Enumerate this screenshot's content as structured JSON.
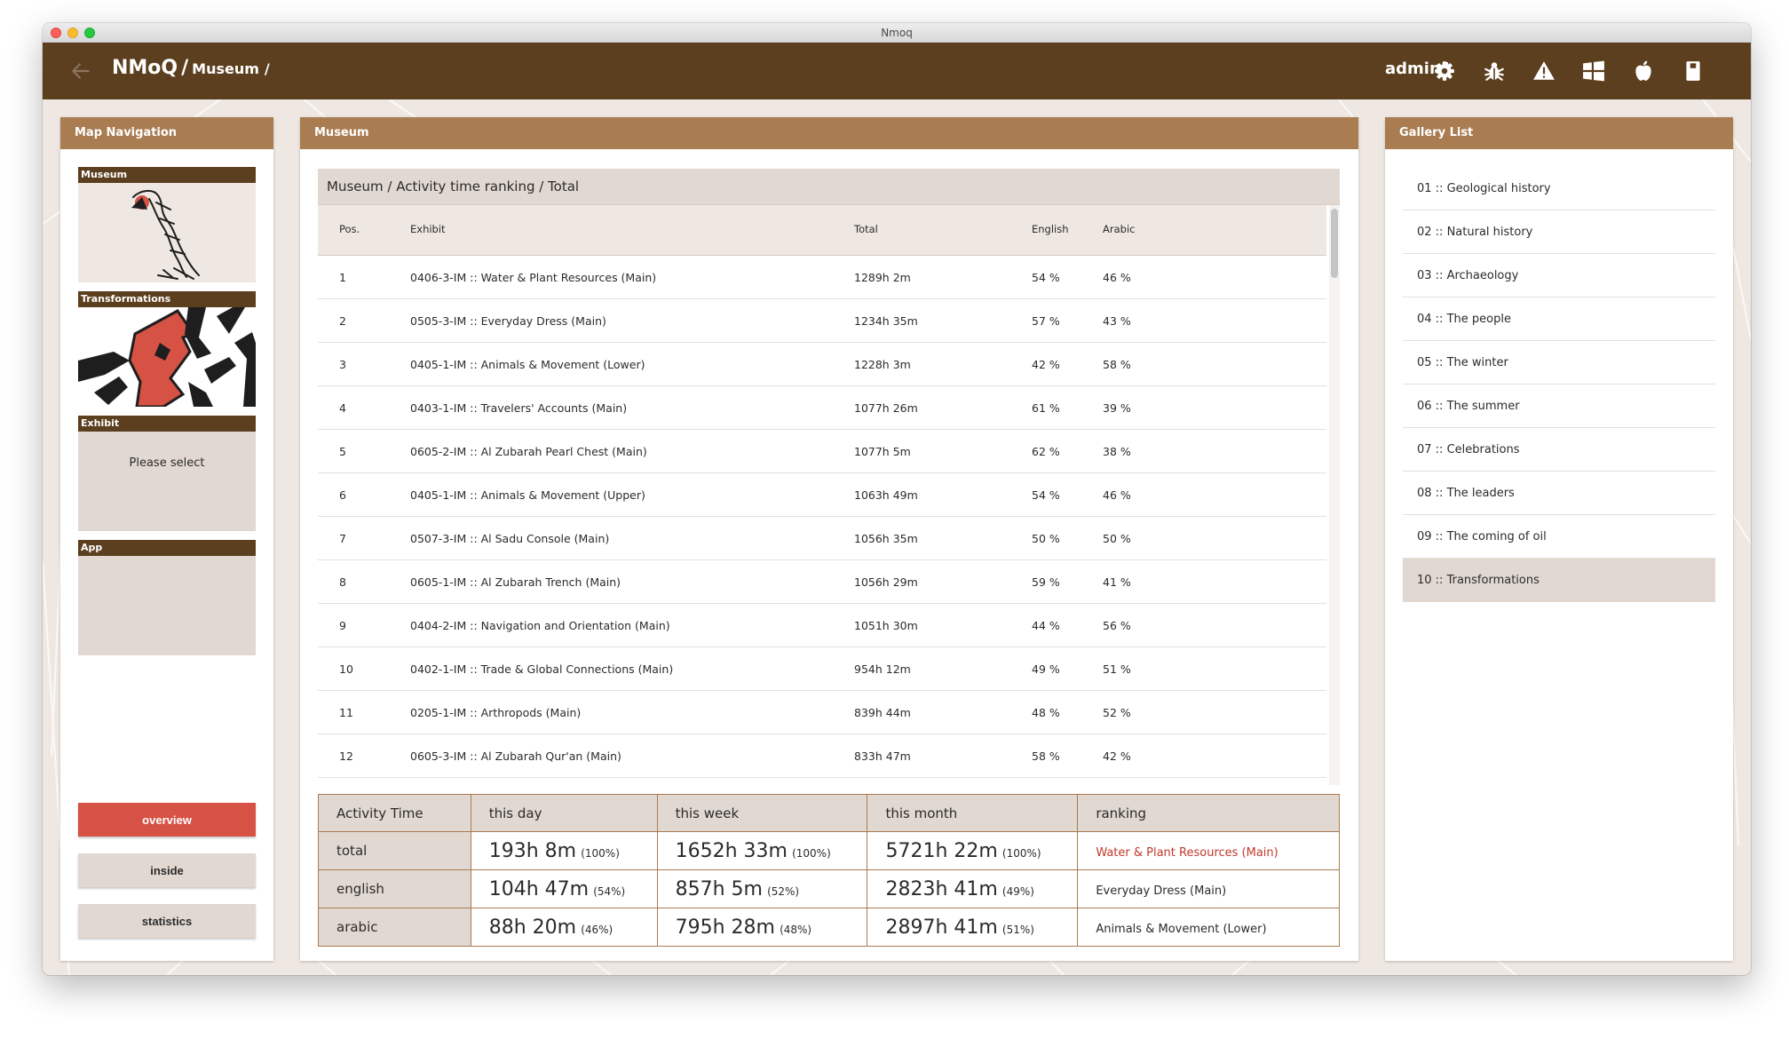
{
  "window": {
    "title": "Nmoq"
  },
  "header": {
    "breadcrumb_root": "NMoQ",
    "breadcrumb_sep": "/",
    "breadcrumb_section": "Museum",
    "breadcrumb_trail": "/",
    "user": "admin1",
    "icons": [
      "arrow-left-icon",
      "gear-icon",
      "bug-icon",
      "warning-icon",
      "windows-icon",
      "apple-icon",
      "android-icon"
    ]
  },
  "left_panel": {
    "title": "Map Navigation",
    "cards": {
      "museum": "Museum",
      "transformations": "Transformations",
      "exhibit": "Exhibit",
      "exhibit_placeholder": "Please select",
      "app": "App"
    },
    "buttons": {
      "overview": "overview",
      "inside": "inside",
      "statistics": "statistics"
    }
  },
  "main": {
    "title": "Museum",
    "ranking": {
      "title": "Museum / Activity time ranking / Total",
      "columns": {
        "pos": "Pos.",
        "exhibit": "Exhibit",
        "total": "Total",
        "english": "English",
        "arabic": "Arabic"
      },
      "rows": [
        {
          "pos": "1",
          "exhibit": "0406-3-IM :: Water & Plant Resources (Main)",
          "total": "1289h 2m",
          "english": "54 %",
          "arabic": "46 %"
        },
        {
          "pos": "2",
          "exhibit": "0505-3-IM :: Everyday Dress (Main)",
          "total": "1234h 35m",
          "english": "57 %",
          "arabic": "43 %"
        },
        {
          "pos": "3",
          "exhibit": "0405-1-IM :: Animals & Movement (Lower)",
          "total": "1228h 3m",
          "english": "42 %",
          "arabic": "58 %"
        },
        {
          "pos": "4",
          "exhibit": "0403-1-IM :: Travelers' Accounts (Main)",
          "total": "1077h 26m",
          "english": "61 %",
          "arabic": "39 %"
        },
        {
          "pos": "5",
          "exhibit": "0605-2-IM :: Al Zubarah Pearl Chest (Main)",
          "total": "1077h 5m",
          "english": "62 %",
          "arabic": "38 %"
        },
        {
          "pos": "6",
          "exhibit": "0405-1-IM :: Animals & Movement (Upper)",
          "total": "1063h 49m",
          "english": "54 %",
          "arabic": "46 %"
        },
        {
          "pos": "7",
          "exhibit": "0507-3-IM :: Al Sadu Console (Main)",
          "total": "1056h 35m",
          "english": "50 %",
          "arabic": "50 %"
        },
        {
          "pos": "8",
          "exhibit": "0605-1-IM :: Al Zubarah Trench (Main)",
          "total": "1056h 29m",
          "english": "59 %",
          "arabic": "41 %"
        },
        {
          "pos": "9",
          "exhibit": "0404-2-IM :: Navigation and Orientation (Main)",
          "total": "1051h 30m",
          "english": "44 %",
          "arabic": "56 %"
        },
        {
          "pos": "10",
          "exhibit": "0402-1-IM :: Trade & Global Connections (Main)",
          "total": "954h 12m",
          "english": "49 %",
          "arabic": "51 %"
        },
        {
          "pos": "11",
          "exhibit": "0205-1-IM :: Arthropods (Main)",
          "total": "839h 44m",
          "english": "48 %",
          "arabic": "52 %"
        },
        {
          "pos": "12",
          "exhibit": "0605-3-IM :: Al Zubarah Qur'an (Main)",
          "total": "833h 47m",
          "english": "58 %",
          "arabic": "42 %"
        }
      ]
    },
    "summary": {
      "headers": [
        "Activity Time",
        "this day",
        "this week",
        "this month",
        "ranking"
      ],
      "rows": [
        {
          "label": "total",
          "day": "193h 8m",
          "day_pct": "(100%)",
          "week": "1652h 33m",
          "week_pct": "(100%)",
          "month": "5721h 22m",
          "month_pct": "(100%)",
          "ranking": "Water & Plant Resources (Main)"
        },
        {
          "label": "english",
          "day": "104h 47m",
          "day_pct": "(54%)",
          "week": "857h 5m",
          "week_pct": "(52%)",
          "month": "2823h 41m",
          "month_pct": "(49%)",
          "ranking": "Everyday Dress (Main)"
        },
        {
          "label": "arabic",
          "day": "88h 20m",
          "day_pct": "(46%)",
          "week": "795h 28m",
          "week_pct": "(48%)",
          "month": "2897h 41m",
          "month_pct": "(51%)",
          "ranking": "Animals & Movement (Lower)"
        }
      ]
    }
  },
  "right_panel": {
    "title": "Gallery List",
    "items": [
      "01 :: Geological history",
      "02 :: Natural history",
      "03 :: Archaeology",
      "04 :: The people",
      "05 :: The winter",
      "06 :: The summer",
      "07 :: Celebrations",
      "08 :: The leaders",
      "09 :: The coming of oil",
      "10 :: Transformations"
    ],
    "selected_index": 9
  },
  "colors": {
    "brand_dark": "#5c3f1e",
    "brand_header": "#a97c52",
    "surface_tan": "#e1d8d1",
    "background": "#efe8e2",
    "accent_red": "#d55245",
    "ranking_highlight": "#c0392b"
  }
}
